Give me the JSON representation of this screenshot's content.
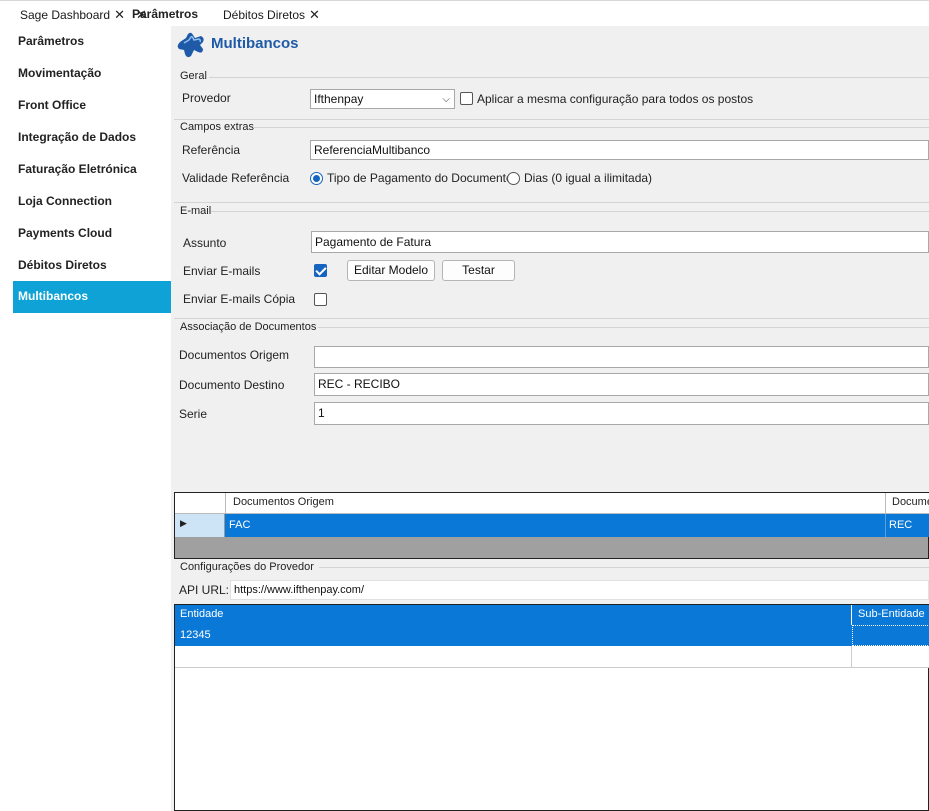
{
  "tabs": [
    {
      "label": "Sage Dashboard",
      "close": "✕"
    },
    {
      "label": "Parâmetros",
      "close": "✕"
    },
    {
      "label": "Débitos Diretos",
      "close": "✕"
    }
  ],
  "sidebar": {
    "items": [
      {
        "label": "Parâmetros"
      },
      {
        "label": "Movimentação"
      },
      {
        "label": "Front Office"
      },
      {
        "label": "Integração de Dados"
      },
      {
        "label": "Faturação Eletrónica"
      },
      {
        "label": "Loja Connection"
      },
      {
        "label": "Payments Cloud"
      },
      {
        "label": "Débitos Diretos"
      },
      {
        "label": "Multibancos"
      }
    ],
    "active_index": 8
  },
  "header": {
    "title": "Multibancos",
    "icon": "puzzle-icon"
  },
  "geral": {
    "section": "Geral",
    "provedor_label": "Provedor",
    "provedor_value": "Ifthenpay",
    "aplicar_label": "Aplicar a mesma configuração para todos os postos",
    "aplicar_checked": false
  },
  "campos": {
    "section": "Campos extras",
    "referencia_label": "Referência",
    "referencia_value": "ReferenciaMultibanco",
    "validade_label": "Validade Referência",
    "option1": "Tipo de Pagamento do Documento",
    "option2": "Dias (0 igual a ilimitada)",
    "selected": 1
  },
  "email": {
    "section": "E-mail",
    "assunto_label": "Assunto",
    "assunto_value": "Pagamento de Fatura",
    "enviar_label": "Enviar E-mails",
    "enviar_checked": true,
    "editar_btn": "Editar Modelo",
    "testar_btn": "Testar",
    "copia_label": "Enviar E-mails Cópia",
    "copia_checked": false
  },
  "associacao": {
    "section": "Associação de Documentos",
    "origem_label": "Documentos Origem",
    "origem_value": "",
    "destino_label": "Documento Destino",
    "destino_value": "REC - RECIBO",
    "serie_label": "Serie",
    "serie_value": "1"
  },
  "grid1": {
    "columns": [
      "Documentos Origem",
      "Docume"
    ],
    "rows": [
      [
        "FAC",
        "REC"
      ]
    ]
  },
  "provedor_config": {
    "section": "Configurações do Provedor",
    "api_label": "API URL:",
    "api_value": "https://www.ifthenpay.com/"
  },
  "grid2": {
    "columns": [
      "Entidade",
      "Sub-Entidade"
    ],
    "rows": [
      [
        "12345",
        ""
      ]
    ]
  },
  "colors": {
    "accent": "#0ea2d6",
    "selection": "#0a78d7",
    "title": "#1e5aa8"
  }
}
